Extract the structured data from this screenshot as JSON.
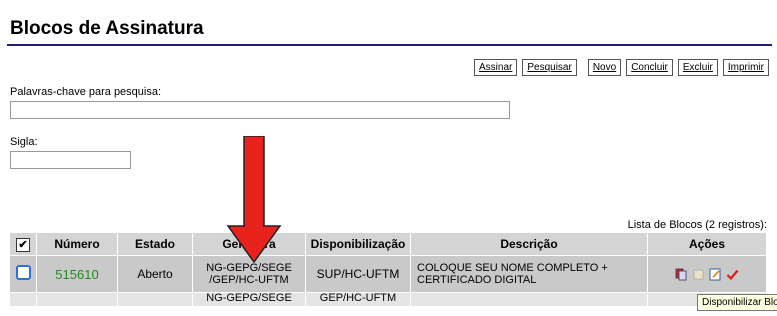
{
  "page": {
    "title": "Blocos de Assinatura"
  },
  "toolbar": {
    "assinar": "Assinar",
    "pesquisar": "Pesquisar",
    "novo": "Novo",
    "concluir": "Concluir",
    "excluir": "Excluir",
    "imprimir": "Imprimir"
  },
  "search": {
    "keywords_label": "Palavras-chave para pesquisa:",
    "keywords_value": "",
    "sigla_label": "Sigla:",
    "sigla_value": ""
  },
  "table": {
    "caption": "Lista de Blocos (2 registros):",
    "headers": {
      "check": "✔",
      "numero": "Número",
      "estado": "Estado",
      "geradora": "Geradora",
      "disponibilizacao": "Disponibilização",
      "descricao": "Descrição",
      "acoes": "Ações"
    },
    "rows": [
      {
        "numero": "515610",
        "estado": "Aberto",
        "geradora": "NG-GEPG/SEGE /GEP/HC-UFTM",
        "disponibilizacao": "SUP/HC-UFTM",
        "descricao": "COLOQUE SEU NOME COMPLETO + CERTIFICADO DIGITAL"
      },
      {
        "numero": "",
        "estado": "",
        "geradora": "NG-GEPG/SEGE",
        "disponibilizacao": "GEP/HC-UFTM",
        "descricao": ""
      }
    ]
  },
  "tooltip": "Disponibilizar Bloc",
  "icons": [
    "documents-icon",
    "block-icon",
    "edit-icon",
    "check-icon",
    "pencil-icon"
  ],
  "colors": {
    "arrow": "#e8231d",
    "number": "#1f8a1f",
    "title_rule": "#1f1f7a"
  }
}
